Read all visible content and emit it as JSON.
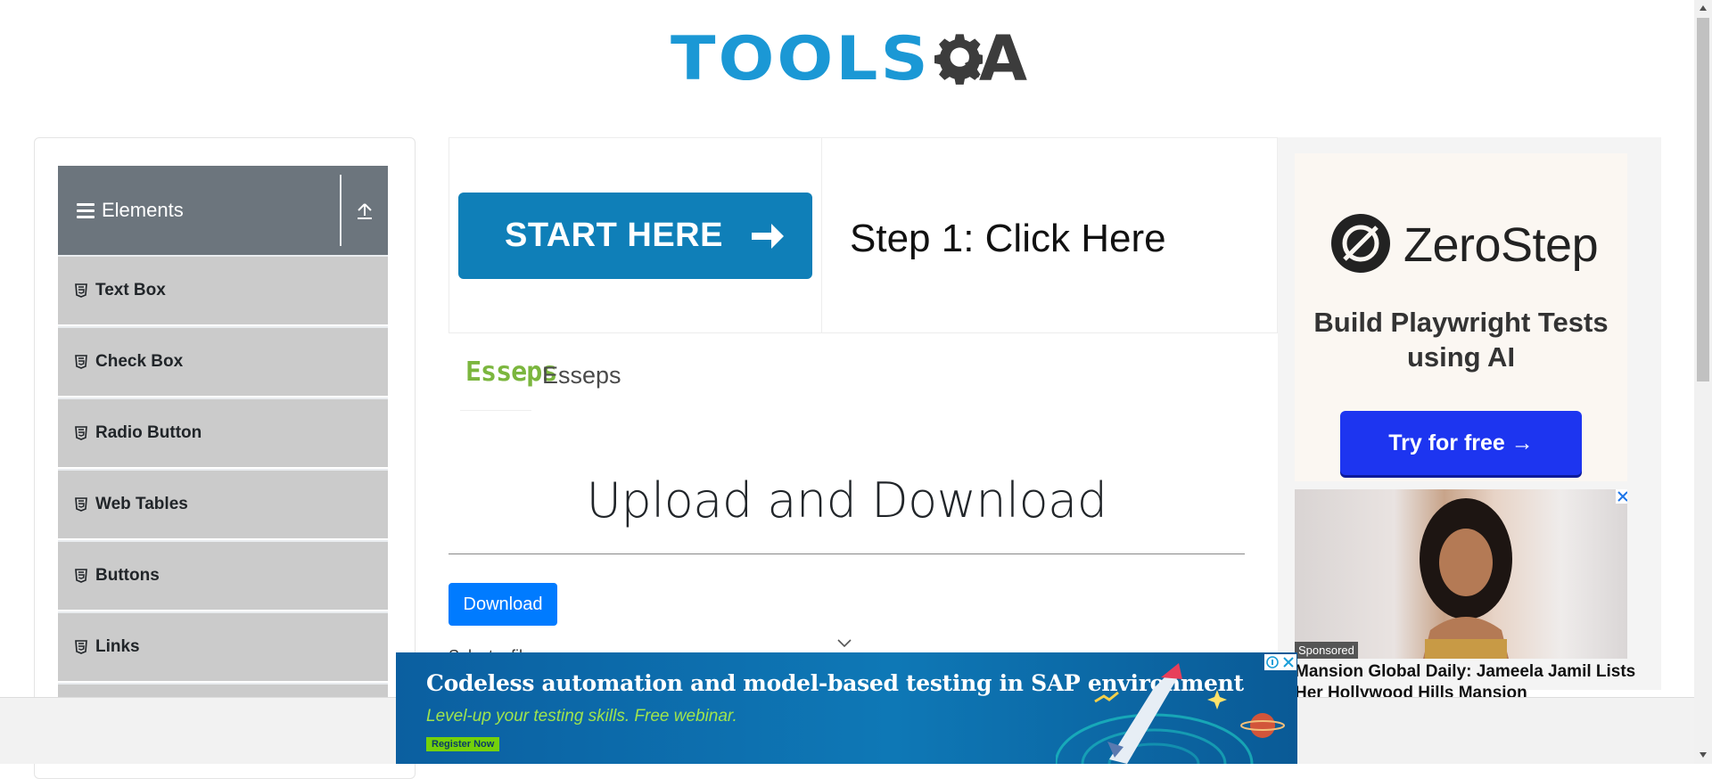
{
  "header": {
    "logo_text_blue": "TOOLS",
    "logo_text_dark": "A"
  },
  "sidebar": {
    "group_title": "Elements",
    "items": [
      {
        "label": "Text Box"
      },
      {
        "label": "Check Box"
      },
      {
        "label": "Radio Button"
      },
      {
        "label": "Web Tables"
      },
      {
        "label": "Buttons"
      },
      {
        "label": "Links"
      }
    ]
  },
  "promo": {
    "start_label": "START HERE",
    "step_text": "Step 1: Click Here"
  },
  "sponsor": {
    "logo_text": "Esseps",
    "name": "Esseps"
  },
  "main": {
    "title": "Upload and Download",
    "download_label": "Download",
    "select_label": "Select a file"
  },
  "right_ad": {
    "brand": "ZeroStep",
    "tagline": "Build Playwright Tests using AI",
    "cta": "Try for free →",
    "sponsored": "Sponsored",
    "headline": "Mansion Global Daily: Jameela Jamil Lists Her Hollywood Hills Mansion"
  },
  "bottom_ad": {
    "headline": "Codeless automation and model-based testing in SAP environment",
    "sub": "Level-up your testing skills. Free webinar.",
    "register": "Register Now"
  },
  "colors": {
    "accent_blue": "#007bff",
    "sidebar_header": "#6c757d",
    "sidebar_item": "#cbcbcb",
    "promo_blue": "#0f7fb8",
    "zerostep_blue": "#1d35f0"
  }
}
